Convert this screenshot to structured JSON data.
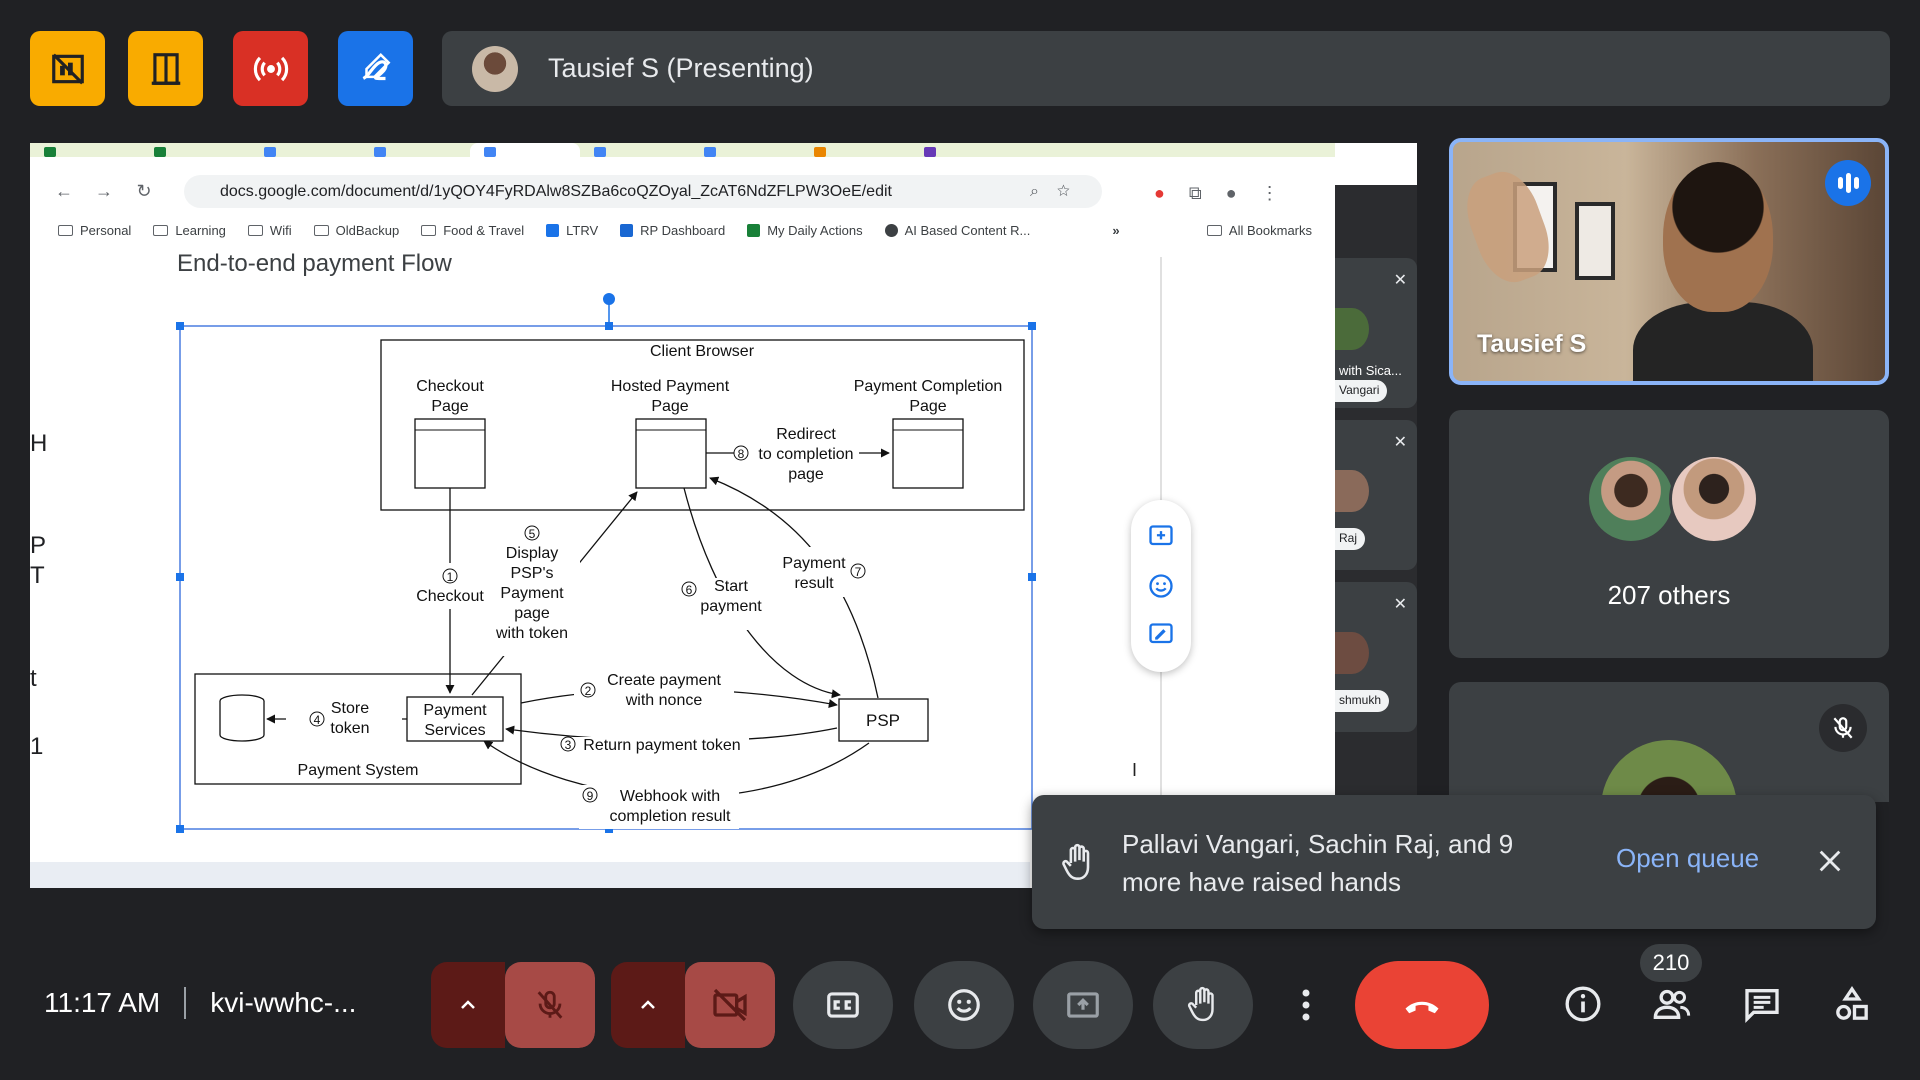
{
  "top_apps": [
    {
      "name": "no-whiteboard",
      "color": "#f9ab00"
    },
    {
      "name": "building",
      "color": "#f9ab00"
    },
    {
      "name": "live-stream",
      "color": "#d93025"
    },
    {
      "name": "annotate",
      "color": "#1a73e8"
    }
  ],
  "presenter": {
    "label": "Tausief S (Presenting)"
  },
  "browser": {
    "url": "docs.google.com/document/d/1yQOY4FyRDAlw8SZBa6coQZOyal_ZcAT6NdZFLPW3OeE/edit",
    "bookmarks": [
      "Personal",
      "Learning",
      "Wifi",
      "OldBackup",
      "Food & Travel",
      "LTRV",
      "RP Dashboard",
      "My Daily Actions",
      "AI Based Content R..."
    ],
    "all_bookmarks": "All Bookmarks"
  },
  "document": {
    "heading": "End-to-end payment Flow",
    "left_letters": [
      "H",
      "P",
      "T",
      "t",
      "1"
    ]
  },
  "diagram": {
    "client_browser": "Client Browser",
    "checkout_page": [
      "Checkout",
      "Page"
    ],
    "hosted_payment_page": [
      "Hosted Payment",
      "Page"
    ],
    "payment_completion_page": [
      "Payment Completion",
      "Page"
    ],
    "redirect": [
      "Redirect",
      "to completion",
      "page"
    ],
    "step8": "8",
    "step5": "5",
    "display_psp": [
      "Display",
      "PSP's",
      "Payment",
      "page",
      "with token"
    ],
    "step1": "1",
    "checkout": "Checkout",
    "step6": "6",
    "start_payment": [
      "Start",
      "payment"
    ],
    "payment_result": [
      "Payment",
      "result"
    ],
    "step7": "7",
    "step2": "2",
    "create_payment": [
      "Create payment",
      "with nonce"
    ],
    "step4": "4",
    "store_token": [
      "Store",
      "token"
    ],
    "payment_services": [
      "Payment",
      "Services"
    ],
    "psp": "PSP",
    "step3": "3",
    "return_token": "Return payment token",
    "payment_system": "Payment System",
    "step9": "9",
    "webhook": [
      "Webhook  with",
      "completion result"
    ]
  },
  "participants": {
    "active_speaker": "Tausief S",
    "others_label": "207 others",
    "side_labels": [
      "with Sica...",
      "Vangari",
      "Raj",
      "shmukh"
    ]
  },
  "toast": {
    "message": "Pallavi Vangari, Sachin Raj, and 9 more have raised hands",
    "action": "Open queue"
  },
  "controls": {
    "time": "11:17 AM",
    "meeting_code": "kvi-wwhc-...",
    "participant_count": "210"
  },
  "colors": {
    "accent_blue": "#8ab4f8",
    "end_call_red": "#ea4335",
    "muted_red": "#a74a46"
  }
}
